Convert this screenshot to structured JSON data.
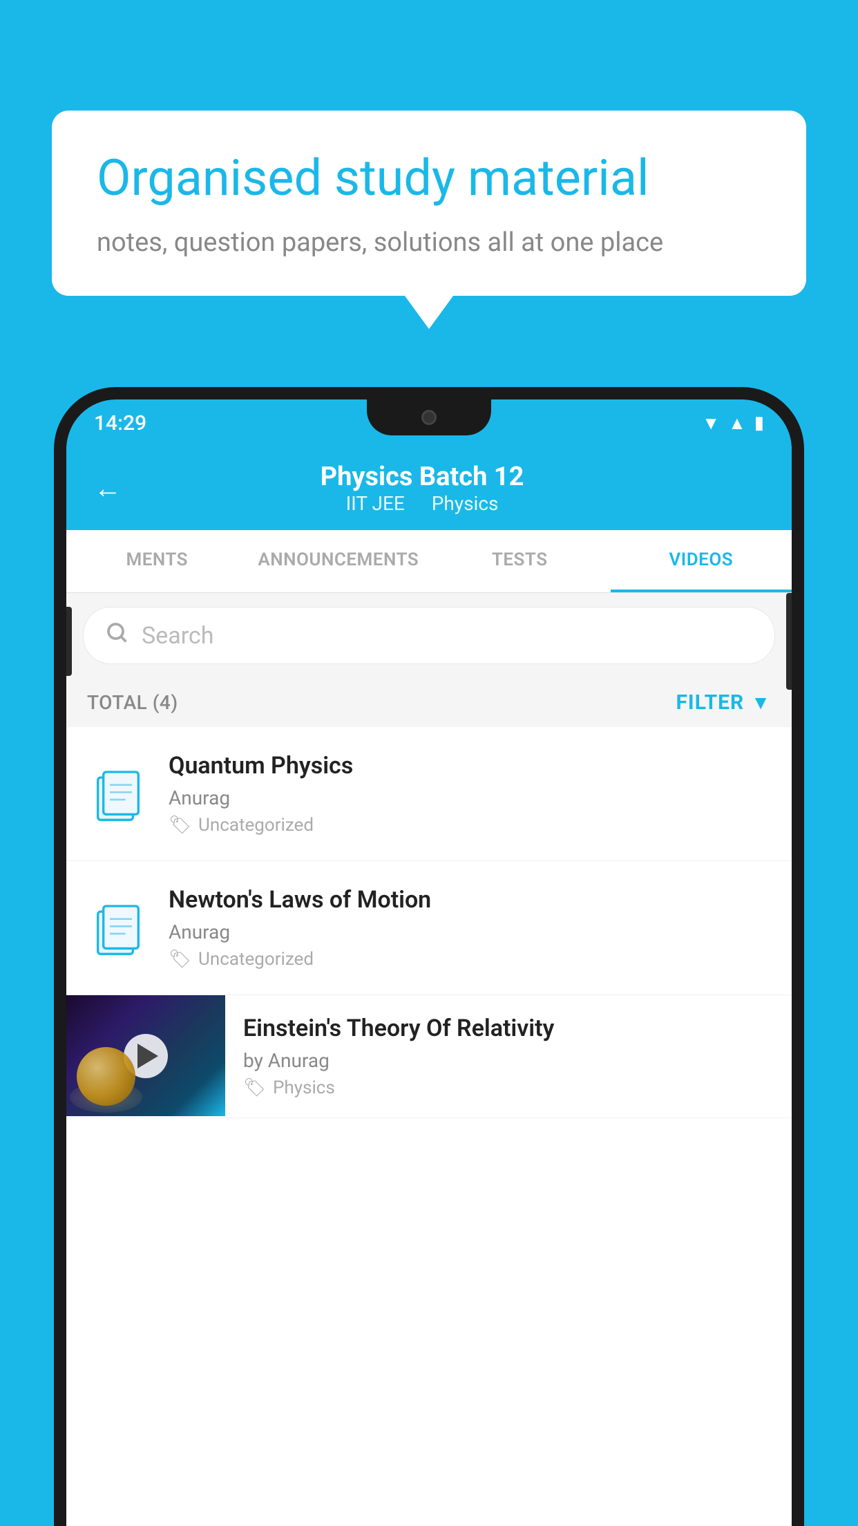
{
  "background": {
    "color": "#1ab8e8"
  },
  "speech_bubble": {
    "title": "Organised study material",
    "subtitle": "notes, question papers, solutions all at one place"
  },
  "status_bar": {
    "time": "14:29",
    "icons": [
      "wifi",
      "signal",
      "battery"
    ]
  },
  "header": {
    "title": "Physics Batch 12",
    "subtitle1": "IIT JEE",
    "subtitle2": "Physics",
    "back_label": "←"
  },
  "tabs": [
    {
      "label": "MENTS",
      "active": false
    },
    {
      "label": "ANNOUNCEMENTS",
      "active": false
    },
    {
      "label": "TESTS",
      "active": false
    },
    {
      "label": "VIDEOS",
      "active": true
    }
  ],
  "search": {
    "placeholder": "Search"
  },
  "filter_row": {
    "total_label": "TOTAL (4)",
    "filter_label": "FILTER"
  },
  "list_items": [
    {
      "title": "Quantum Physics",
      "author": "Anurag",
      "tag": "Uncategorized",
      "type": "file"
    },
    {
      "title": "Newton's Laws of Motion",
      "author": "Anurag",
      "tag": "Uncategorized",
      "type": "file"
    }
  ],
  "video_item": {
    "title": "Einstein's Theory Of Relativity",
    "author": "by Anurag",
    "tag": "Physics",
    "type": "video"
  }
}
